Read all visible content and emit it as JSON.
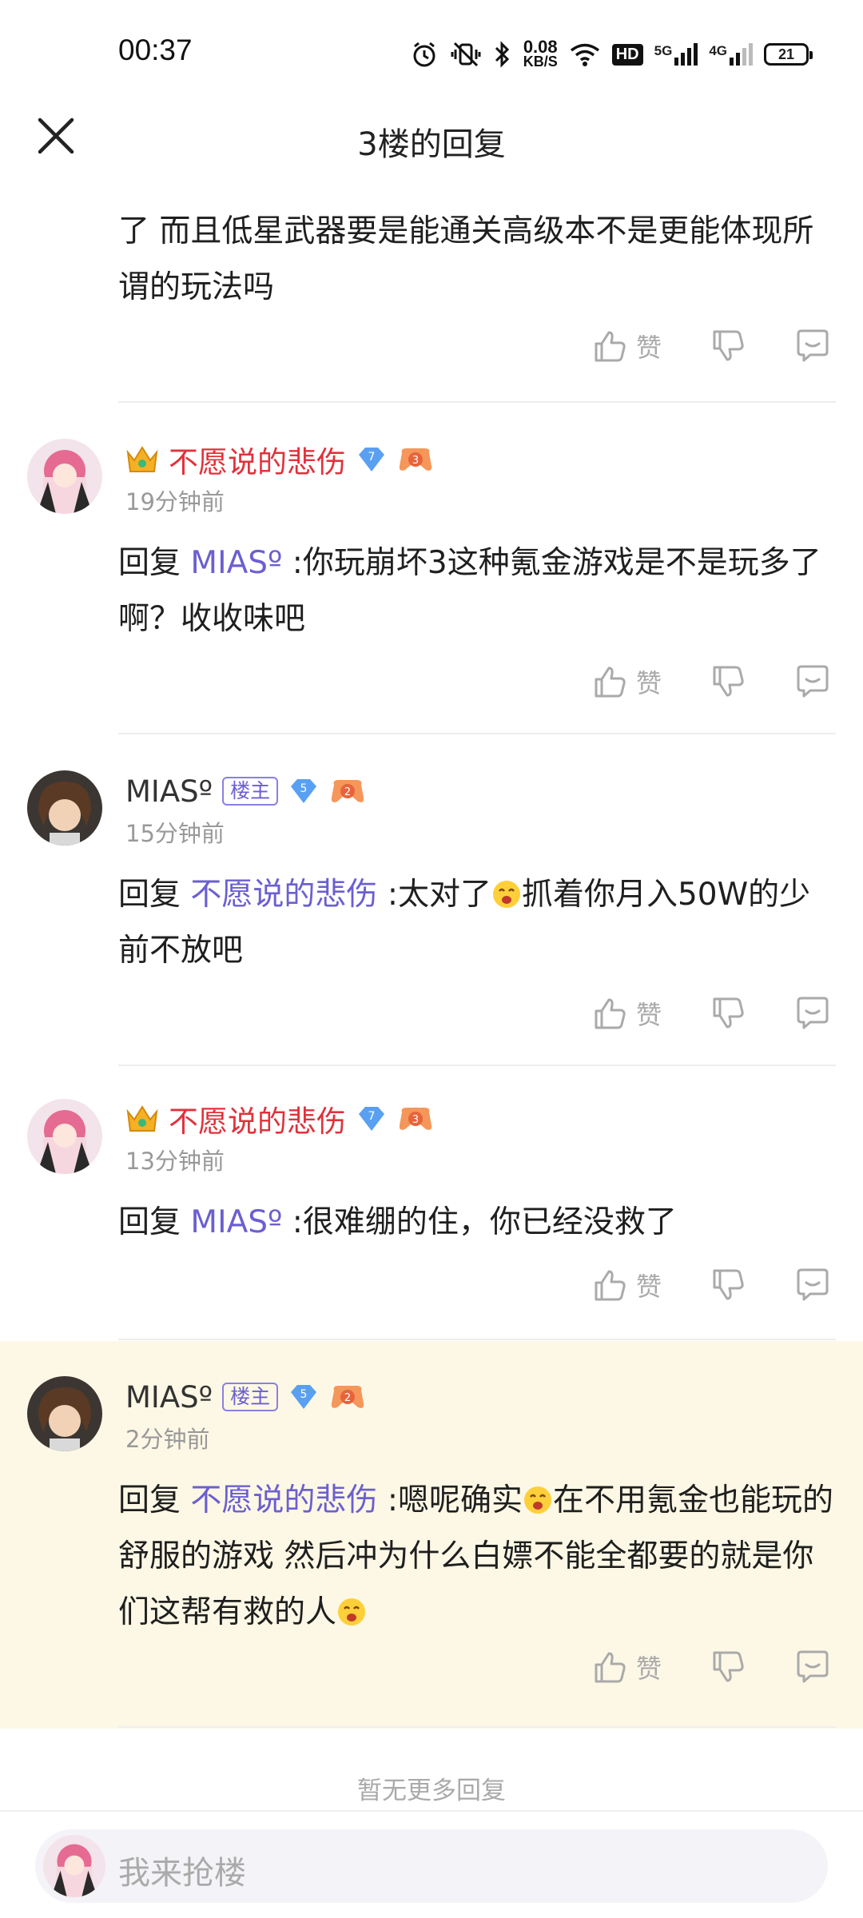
{
  "status_bar": {
    "time": "00:37",
    "net_speed_value": "0.08",
    "net_speed_unit": "KB/S",
    "hd_label": "HD",
    "net_5g": "5G",
    "net_4g": "4G",
    "battery": "21"
  },
  "header": {
    "title": "3楼的回复"
  },
  "top_comment": {
    "content": "了 而且低星武器要是能通关高级本不是更能体现所谓的玩法吗",
    "like_label": "赞"
  },
  "replies": [
    {
      "username": "不愿说的悲伤",
      "vip_level": "7",
      "game_level": "3",
      "time": "19分钟前",
      "reply_prefix": "回复",
      "mention": "MIASº",
      "text": " :你玩崩坏3这种氪金游戏是不是玩多了啊？收收味吧",
      "like_label": "赞"
    },
    {
      "username": "MIASº",
      "owner_badge": "楼主",
      "vip_level": "5",
      "game_level": "2",
      "time": "15分钟前",
      "reply_prefix": "回复",
      "mention": "不愿说的悲伤",
      "text_before_emoji": " :太对了",
      "text_after_emoji": "抓着你月入50W的少前不放吧",
      "like_label": "赞"
    },
    {
      "username": "不愿说的悲伤",
      "vip_level": "7",
      "game_level": "3",
      "time": "13分钟前",
      "reply_prefix": "回复",
      "mention": "MIASº",
      "text": " :很难绷的住，你已经没救了",
      "like_label": "赞"
    },
    {
      "username": "MIASº",
      "owner_badge": "楼主",
      "vip_level": "5",
      "game_level": "2",
      "time": "2分钟前",
      "reply_prefix": "回复",
      "mention": "不愿说的悲伤",
      "text_before_emoji": " :嗯呢确实",
      "text_after_emoji": "在不用氪金也能玩的舒服的游戏 然后冲为什么白嫖不能全都要的就是你们这帮有救的人",
      "like_label": "赞"
    }
  ],
  "footer": {
    "no_more": "暂无更多回复",
    "input_placeholder": "我来抢楼"
  },
  "colors": {
    "accent_purple": "#6b5fd0",
    "username_red": "#e0323c",
    "highlight_bg": "#fdf8e6"
  }
}
